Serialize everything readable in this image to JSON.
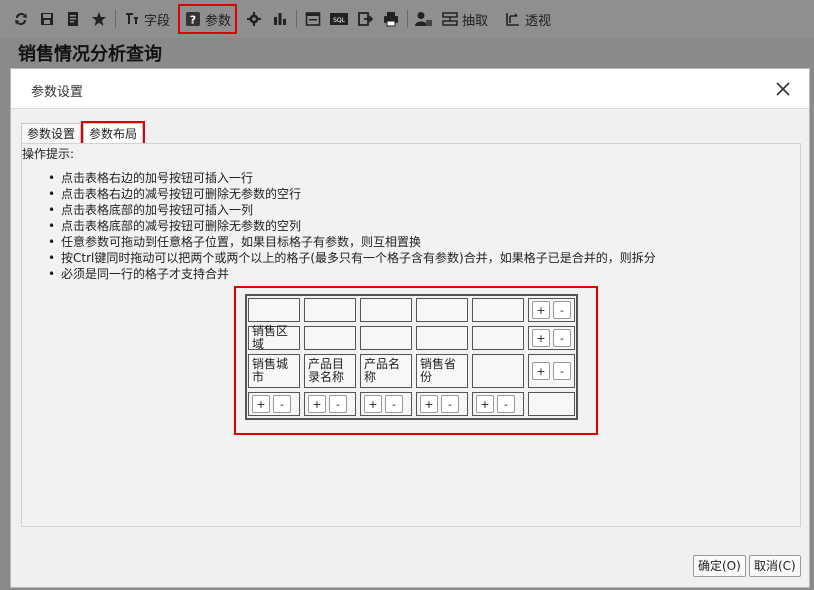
{
  "toolbar": {
    "field_label": "字段",
    "params_label": "参数",
    "extract_label": "抽取",
    "pivot_label": "透视",
    "sql_label": "SQL"
  },
  "page": {
    "title": "销售情况分析查询"
  },
  "dialog": {
    "title": "参数设置",
    "tabs": [
      "参数设置",
      "参数布局"
    ],
    "hint_title": "操作提示:",
    "hints": [
      "点击表格右边的加号按钮可插入一行",
      "点击表格右边的减号按钮可删除无参数的空行",
      "点击表格底部的加号按钮可插入一列",
      "点击表格底部的减号按钮可删除无参数的空列",
      "任意参数可拖动到任意格子位置，如果目标格子有参数，则互相置换",
      "按Ctrl键同时拖动可以把两个或两个以上的格子(最多只有一个格子含有参数)合并，如果格子已是合并的，则拆分",
      "必须是同一行的格子才支持合并"
    ],
    "grid": {
      "rows": [
        [
          "",
          "",
          "",
          "",
          ""
        ],
        [
          "销售区域",
          "",
          "",
          "",
          ""
        ],
        [
          "销售城市",
          "产品目录名称",
          "产品名称",
          "销售省份",
          ""
        ]
      ],
      "plus": "+",
      "minus": "-"
    },
    "ok_label": "确定(O)",
    "cancel_label": "取消(C)"
  }
}
